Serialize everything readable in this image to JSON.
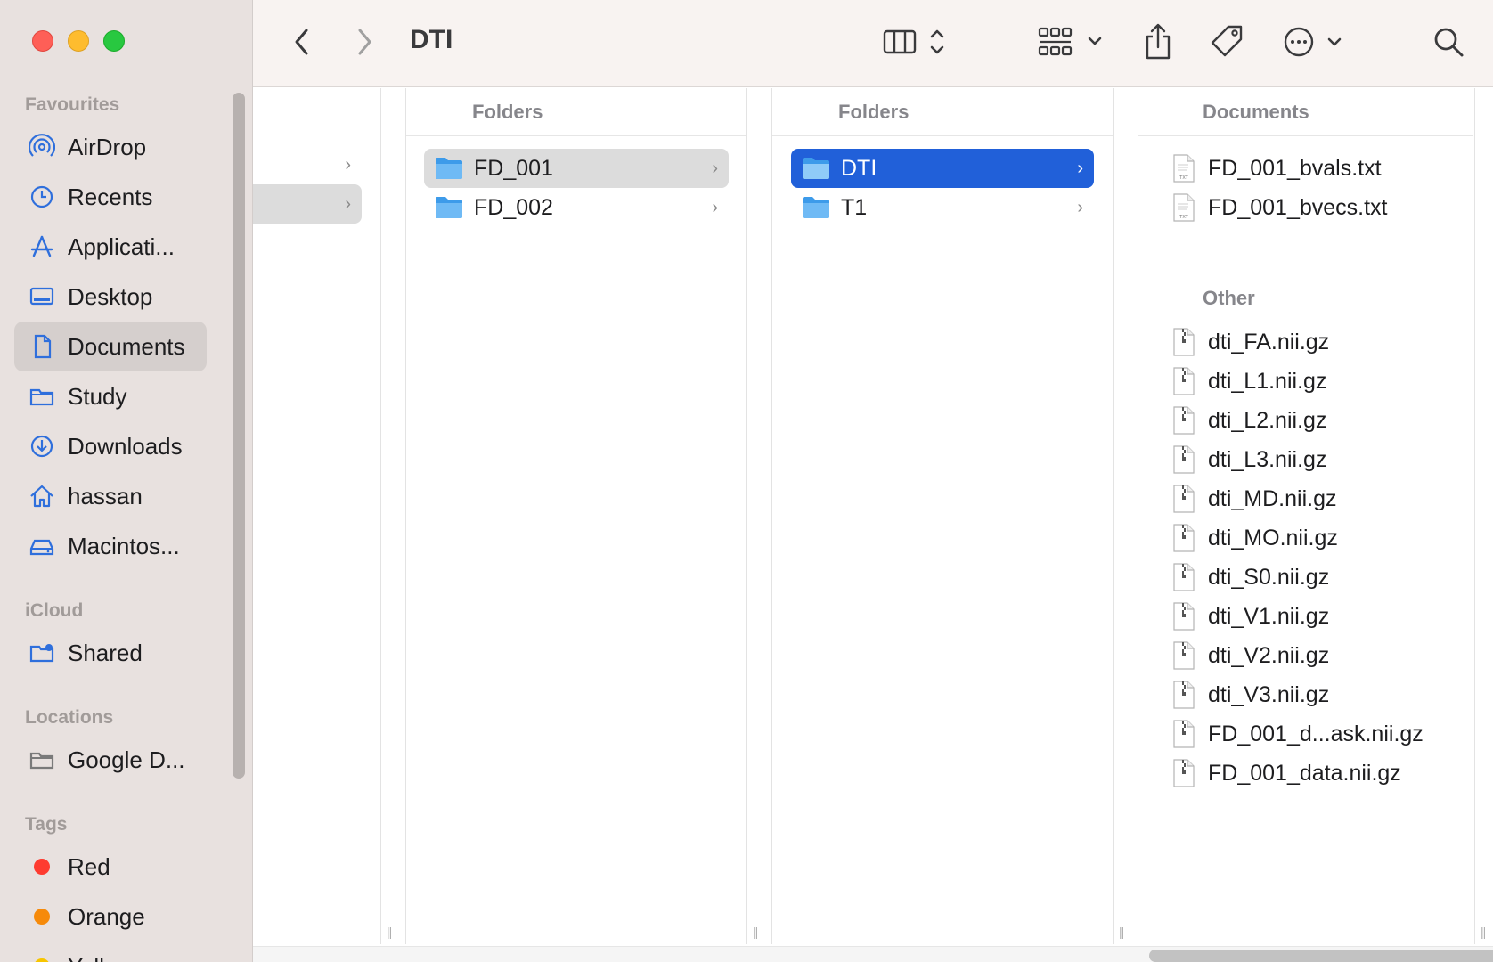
{
  "window": {
    "title": "DTI"
  },
  "sidebar": {
    "sections": [
      {
        "label": "Favourites"
      },
      {
        "label": "iCloud"
      },
      {
        "label": "Locations"
      },
      {
        "label": "Tags"
      }
    ],
    "favourites": [
      {
        "label": "AirDrop",
        "icon": "airdrop-icon"
      },
      {
        "label": "Recents",
        "icon": "clock-icon"
      },
      {
        "label": "Applicati...",
        "icon": "applications-icon"
      },
      {
        "label": "Desktop",
        "icon": "desktop-icon"
      },
      {
        "label": "Documents",
        "icon": "document-icon",
        "selected": true
      },
      {
        "label": "Study",
        "icon": "folder-icon"
      },
      {
        "label": "Downloads",
        "icon": "download-icon"
      },
      {
        "label": "hassan",
        "icon": "home-icon"
      },
      {
        "label": "Macintos...",
        "icon": "disk-icon"
      }
    ],
    "icloud": [
      {
        "label": "Shared",
        "icon": "shared-folder-icon"
      }
    ],
    "locations": [
      {
        "label": "Google D...",
        "icon": "folder-icon"
      }
    ],
    "tags": [
      {
        "label": "Red",
        "color": "#fe3b30"
      },
      {
        "label": "Orange",
        "color": "#f68a0a"
      },
      {
        "label": "Yello",
        "color": "#f7c500"
      }
    ]
  },
  "columns": {
    "col2": {
      "header": "Folders",
      "items": [
        {
          "label": "FD_001",
          "selected": "grey"
        },
        {
          "label": "FD_002"
        }
      ]
    },
    "col3": {
      "header": "Folders",
      "items": [
        {
          "label": "DTI",
          "selected": "blue"
        },
        {
          "label": "T1"
        }
      ]
    },
    "col4": {
      "header": "Documents",
      "documents": [
        {
          "label": "FD_001_bvals.txt"
        },
        {
          "label": "FD_001_bvecs.txt"
        }
      ],
      "other_header": "Other",
      "other": [
        {
          "label": "dti_FA.nii.gz"
        },
        {
          "label": "dti_L1.nii.gz"
        },
        {
          "label": "dti_L2.nii.gz"
        },
        {
          "label": "dti_L3.nii.gz"
        },
        {
          "label": "dti_MD.nii.gz"
        },
        {
          "label": "dti_MO.nii.gz"
        },
        {
          "label": "dti_S0.nii.gz"
        },
        {
          "label": "dti_V1.nii.gz"
        },
        {
          "label": "dti_V2.nii.gz"
        },
        {
          "label": "dti_V3.nii.gz"
        },
        {
          "label": "FD_001_d...ask.nii.gz"
        },
        {
          "label": "FD_001_data.nii.gz"
        }
      ]
    }
  },
  "colors": {
    "accent": "#2160d9",
    "sidebar_bg": "#e8e1df",
    "toolbar_bg": "#f8f3f1"
  }
}
